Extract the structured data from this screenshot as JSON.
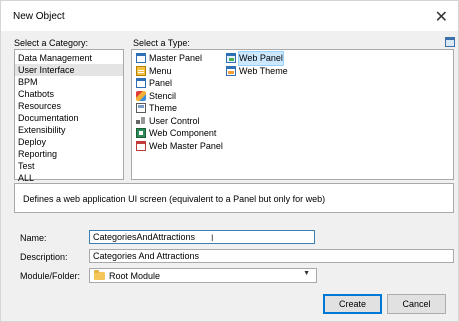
{
  "window": {
    "title": "New Object",
    "close_symbol": "✕"
  },
  "category": {
    "label": "Select a Category:",
    "items": [
      "Data Management",
      "User Interface",
      "BPM",
      "Chatbots",
      "Resources",
      "Documentation",
      "Extensibility",
      "Deploy",
      "Reporting",
      "Test",
      "ALL"
    ],
    "selected": "User Interface"
  },
  "type": {
    "label": "Select a Type:",
    "col1": [
      {
        "label": "Master Panel",
        "icon": "master-panel-icon"
      },
      {
        "label": "Menu",
        "icon": "menu-icon"
      },
      {
        "label": "Panel",
        "icon": "panel-icon"
      },
      {
        "label": "Stencil",
        "icon": "stencil-icon"
      },
      {
        "label": "Theme",
        "icon": "theme-icon"
      },
      {
        "label": "User Control",
        "icon": "user-control-icon"
      },
      {
        "label": "Web Component",
        "icon": "web-component-icon"
      },
      {
        "label": "Web Master Panel",
        "icon": "web-master-panel-icon"
      }
    ],
    "col2": [
      {
        "label": "Web Panel",
        "icon": "web-panel-icon"
      },
      {
        "label": "Web Theme",
        "icon": "web-theme-icon"
      }
    ],
    "selected": "Web Panel"
  },
  "description_text": "Defines a web application UI screen (equivalent to a Panel but only for web)",
  "form": {
    "name_label": "Name:",
    "name_value": "CategoriesAndAttractions",
    "description_label": "Description:",
    "description_value": "Categories And Attractions",
    "module_label": "Module/Folder:",
    "module_value": "Root Module"
  },
  "buttons": {
    "create": "Create",
    "cancel": "Cancel"
  },
  "colors": {
    "selection": "#cce8ff",
    "accent": "#0078d7"
  }
}
